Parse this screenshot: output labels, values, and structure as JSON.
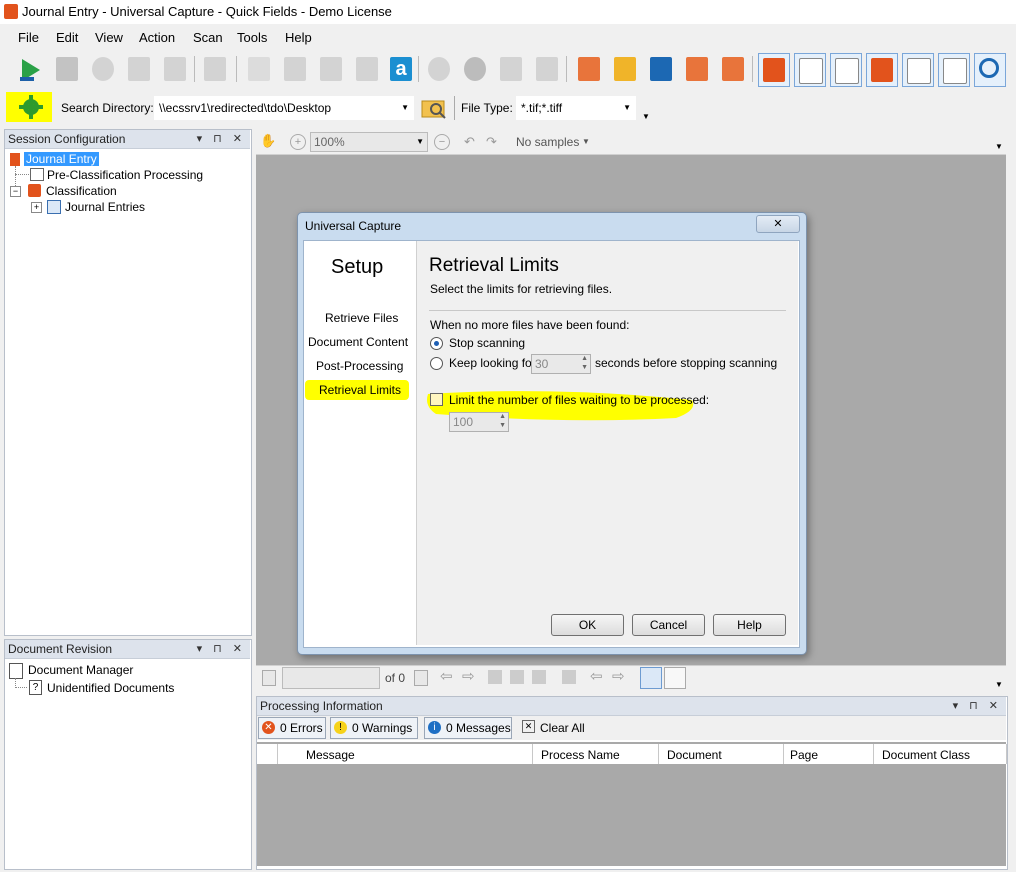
{
  "window": {
    "title": "Journal Entry - Universal Capture - Quick Fields - Demo License"
  },
  "menubar": {
    "items": [
      "File",
      "Edit",
      "View",
      "Action",
      "Scan",
      "Tools",
      "Help"
    ]
  },
  "dirbar": {
    "search_label": "Search Directory:",
    "search_value": "\\\\ecssrv1\\redirected\\tdo\\Desktop",
    "filetype_label": "File Type:",
    "filetype_value": "*.tif;*.tiff"
  },
  "session_panel": {
    "title": "Session Configuration",
    "tree": {
      "root": "Journal Entry",
      "preclass": "Pre-Classification Processing",
      "classification": "Classification",
      "journal_entries": "Journal Entries"
    }
  },
  "revision_panel": {
    "title": "Document Revision",
    "manager": "Document Manager",
    "unidentified": "Unidentified Documents"
  },
  "viewer": {
    "zoom": "100%",
    "samples": "No samples",
    "page_of": "of 0"
  },
  "dialog": {
    "title": "Universal Capture",
    "setup": "Setup",
    "nav": [
      "Retrieve Files",
      "Document Content",
      "Post-Processing",
      "Retrieval Limits"
    ],
    "selected_nav": 3,
    "heading": "Retrieval Limits",
    "subheading": "Select the limits for retrieving files.",
    "group_label": "When no more files have been found:",
    "opt_stop": "Stop scanning",
    "opt_keep_prefix": "Keep looking for",
    "keep_seconds": "30",
    "opt_keep_suffix": "seconds before stopping scanning",
    "limit_label": "Limit the number of files waiting to be processed:",
    "limit_value": "100",
    "ok": "OK",
    "cancel": "Cancel",
    "help": "Help"
  },
  "processing": {
    "title": "Processing Information",
    "errors": "0 Errors",
    "warnings": "0 Warnings",
    "messages": "0 Messages",
    "clear": "Clear All",
    "columns": [
      "Message",
      "Process Name",
      "Document",
      "Page",
      "Document Class"
    ]
  },
  "colors": {
    "highlight": "#ffff00",
    "accent": "#1e5fb4",
    "brand": "#e2531c"
  }
}
